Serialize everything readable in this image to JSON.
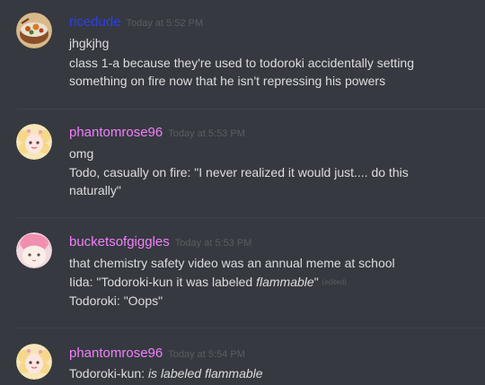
{
  "colors": {
    "background": "#36393f",
    "text": "#dcddde",
    "timestamp": "#5a5d63",
    "user_ricedude": "#2b3ff0",
    "user_phantomrose96": "#f47fff",
    "user_bucketsofgiggles": "#f47fff"
  },
  "messages": [
    {
      "username": "ricedude",
      "timestamp": "Today at 5:52 PM",
      "avatar": "rice-bowl-avatar",
      "lines": [
        "jhgkjhg",
        "class 1-a because they're used to todoroki accidentally setting",
        "something on fire now that he isn't repressing his powers"
      ]
    },
    {
      "username": "phantomrose96",
      "timestamp": "Today at 5:53 PM",
      "avatar": "pastel-character-avatar",
      "lines": [
        "omg",
        "Todo, casually on fire: \"I never realized it would just.... do this",
        "naturally\""
      ]
    },
    {
      "username": "bucketsofgiggles",
      "timestamp": "Today at 5:53 PM",
      "avatar": "pink-hair-character-avatar",
      "lines": [
        "that chemistry safety video was an annual meme at school"
      ],
      "iida_line": {
        "before": "Iida: \"Todoroki-kun it was labeled ",
        "emphasis": "flammable",
        "after": "\"",
        "edited": "(edited)"
      },
      "last_line": "Todoroki: \"Oops\""
    },
    {
      "username": "phantomrose96",
      "timestamp": "Today at 5:54 PM",
      "avatar": "pastel-character-avatar",
      "line": {
        "before": "Todoroki-kun: ",
        "emphasis": "is labeled flammable"
      }
    }
  ]
}
